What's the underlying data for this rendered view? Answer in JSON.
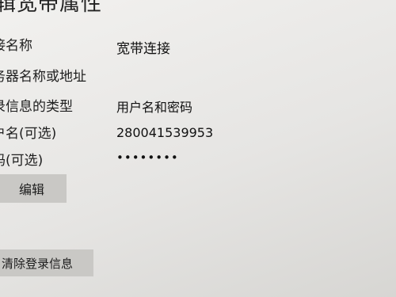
{
  "page": {
    "title": "辑宽带属性"
  },
  "fields": [
    {
      "label": "接名称",
      "value": "宽带连接"
    },
    {
      "label": "务器名称或地址",
      "value": ""
    },
    {
      "label": "录信息的类型",
      "value": "用户名和密码"
    },
    {
      "label": "户名(可选)",
      "value": "280041539953"
    },
    {
      "label": "码(可选)",
      "value": "••••••••"
    }
  ],
  "buttons": {
    "edit": "编辑",
    "clear": "清除登录信息"
  }
}
